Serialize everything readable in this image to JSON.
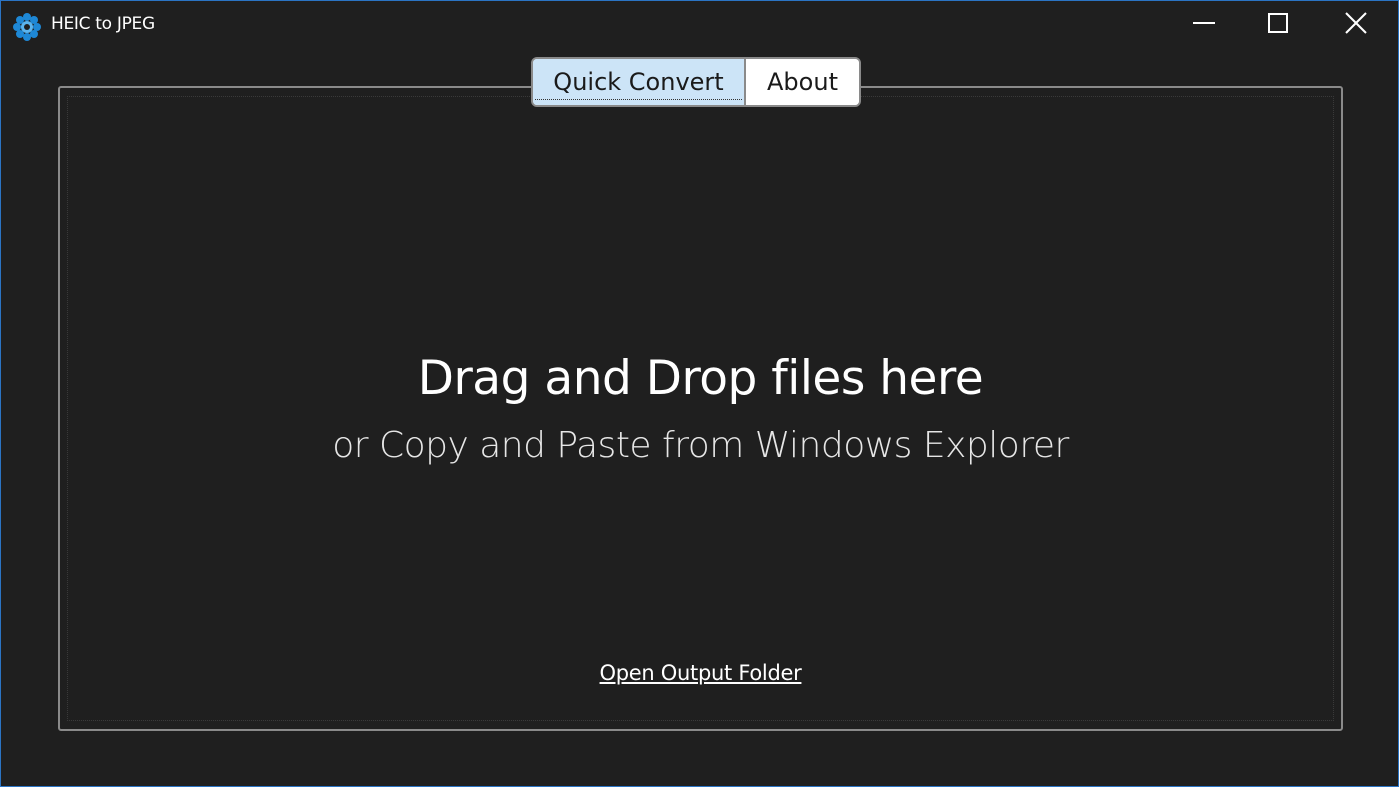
{
  "window": {
    "title": "HEIC to JPEG",
    "icon": "app-gear-logo-icon",
    "controls": {
      "minimize_icon": "minimize-icon",
      "maximize_icon": "maximize-icon",
      "close_icon": "close-icon"
    }
  },
  "tabs": [
    {
      "label": "Quick Convert",
      "selected": true
    },
    {
      "label": "About",
      "selected": false
    }
  ],
  "dropzone": {
    "headline": "Drag and Drop files here",
    "subline": "or Copy and Paste from Windows Explorer"
  },
  "actions": {
    "open_output_folder": "Open Output Folder"
  },
  "colors": {
    "background": "#1f1f1f",
    "window_border": "#2b74c4",
    "tab_selected": "#cce4f7",
    "panel_border": "#8a8a8a",
    "icon_accent": "#1e88d6"
  }
}
